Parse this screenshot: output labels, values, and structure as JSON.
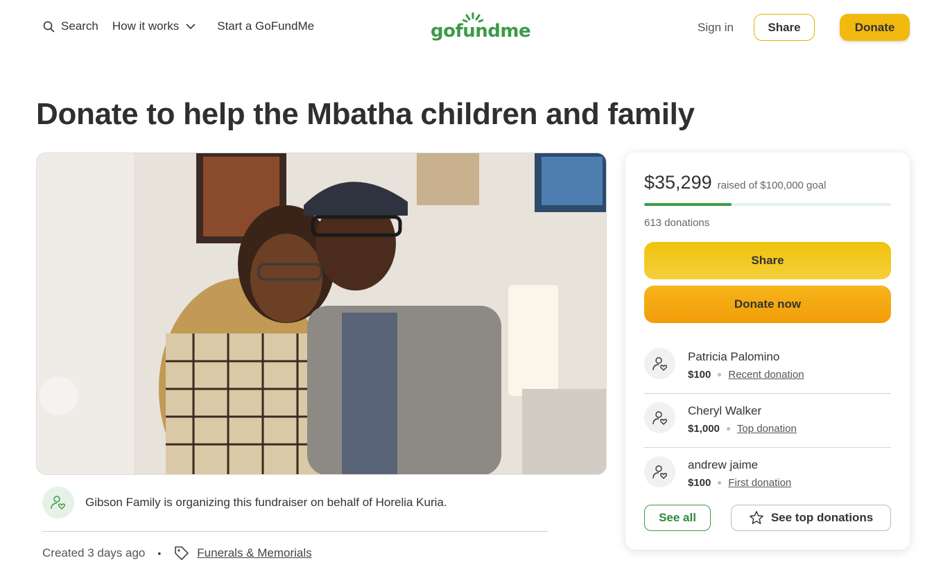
{
  "nav": {
    "search_label": "Search",
    "how_it_works_label": "How it works",
    "start_label": "Start a GoFundMe",
    "logo_text": "gofundme",
    "sign_in_label": "Sign in",
    "share_label": "Share",
    "donate_label": "Donate"
  },
  "page": {
    "title": "Donate to help the Mbatha children and family"
  },
  "organizer": {
    "text": "Gibson Family is organizing this fundraiser on behalf of Horelia Kuria."
  },
  "meta": {
    "created": "Created 3 days ago",
    "separator": "•",
    "category": "Funerals & Memorials"
  },
  "campaign": {
    "raised": "$35,299",
    "goal_text": "raised of $100,000 goal",
    "progress_fraction": 0.353,
    "donations_count": "613 donations",
    "share_label": "Share",
    "donate_now_label": "Donate now",
    "see_all_label": "See all",
    "see_top_label": "See top donations"
  },
  "donors": [
    {
      "name": "Patricia Palomino",
      "amount": "$100",
      "type": "Recent donation"
    },
    {
      "name": "Cheryl Walker",
      "amount": "$1,000",
      "type": "Top donation"
    },
    {
      "name": "andrew jaime",
      "amount": "$100",
      "type": "First donation"
    }
  ],
  "colors": {
    "brand_green": "#3a9d48",
    "donate_yellow": "#f2b90f",
    "donate_orange": "#f19c08"
  }
}
